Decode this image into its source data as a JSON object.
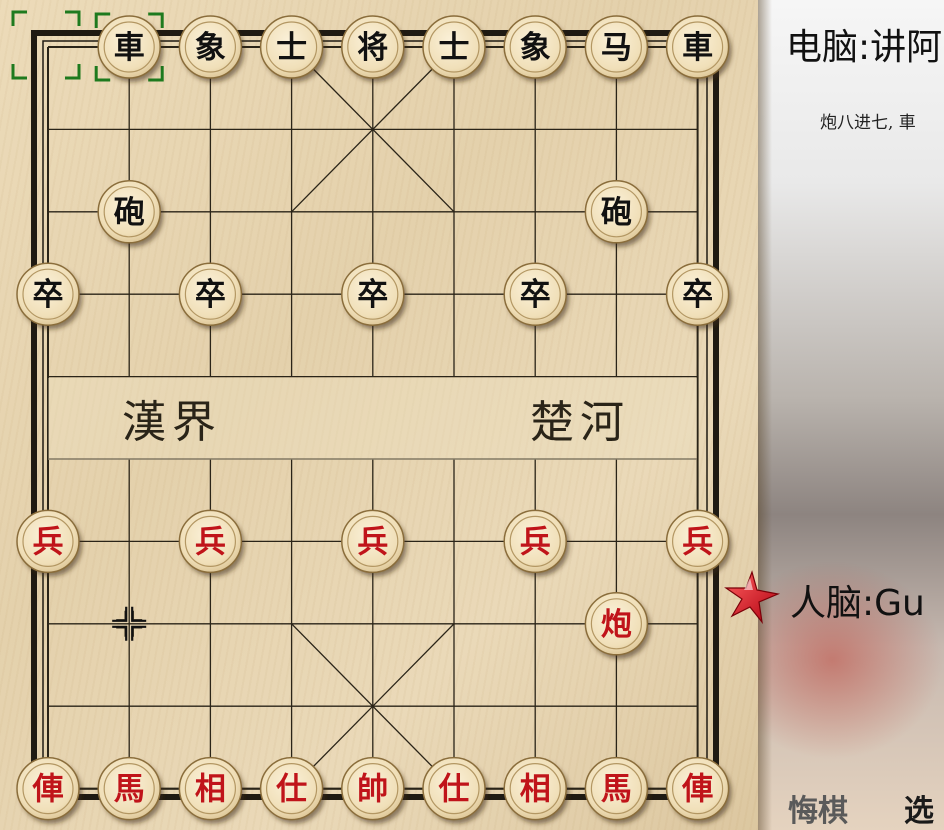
{
  "players": {
    "computer_label": "电脑:讲阿",
    "human_label": "人脑:Gu"
  },
  "move_notation": "炮八进七, 車",
  "buttons": {
    "undo": "悔棋",
    "select": "选"
  },
  "river": {
    "left_text": "漢界",
    "right_text": "楚河"
  },
  "pieces": [
    {
      "label": "車",
      "side": "black",
      "file": 1,
      "rank": 0
    },
    {
      "label": "象",
      "side": "black",
      "file": 2,
      "rank": 0
    },
    {
      "label": "士",
      "side": "black",
      "file": 3,
      "rank": 0
    },
    {
      "label": "将",
      "side": "black",
      "file": 4,
      "rank": 0
    },
    {
      "label": "士",
      "side": "black",
      "file": 5,
      "rank": 0
    },
    {
      "label": "象",
      "side": "black",
      "file": 6,
      "rank": 0
    },
    {
      "label": "马",
      "side": "black",
      "file": 7,
      "rank": 0
    },
    {
      "label": "車",
      "side": "black",
      "file": 8,
      "rank": 0
    },
    {
      "label": "砲",
      "side": "black",
      "file": 1,
      "rank": 2
    },
    {
      "label": "砲",
      "side": "black",
      "file": 7,
      "rank": 2
    },
    {
      "label": "卒",
      "side": "black",
      "file": 0,
      "rank": 3
    },
    {
      "label": "卒",
      "side": "black",
      "file": 2,
      "rank": 3
    },
    {
      "label": "卒",
      "side": "black",
      "file": 4,
      "rank": 3
    },
    {
      "label": "卒",
      "side": "black",
      "file": 6,
      "rank": 3
    },
    {
      "label": "卒",
      "side": "black",
      "file": 8,
      "rank": 3
    },
    {
      "label": "兵",
      "side": "red",
      "file": 0,
      "rank": 6
    },
    {
      "label": "兵",
      "side": "red",
      "file": 2,
      "rank": 6
    },
    {
      "label": "兵",
      "side": "red",
      "file": 4,
      "rank": 6
    },
    {
      "label": "兵",
      "side": "red",
      "file": 6,
      "rank": 6
    },
    {
      "label": "兵",
      "side": "red",
      "file": 8,
      "rank": 6
    },
    {
      "label": "炮",
      "side": "red",
      "file": 7,
      "rank": 7
    },
    {
      "label": "俥",
      "side": "red",
      "file": 0,
      "rank": 9
    },
    {
      "label": "馬",
      "side": "red",
      "file": 1,
      "rank": 9
    },
    {
      "label": "相",
      "side": "red",
      "file": 2,
      "rank": 9
    },
    {
      "label": "仕",
      "side": "red",
      "file": 3,
      "rank": 9
    },
    {
      "label": "帥",
      "side": "red",
      "file": 4,
      "rank": 9
    },
    {
      "label": "仕",
      "side": "red",
      "file": 5,
      "rank": 9
    },
    {
      "label": "相",
      "side": "red",
      "file": 6,
      "rank": 9
    },
    {
      "label": "馬",
      "side": "red",
      "file": 7,
      "rank": 9
    },
    {
      "label": "俥",
      "side": "red",
      "file": 8,
      "rank": 9
    }
  ],
  "last_move": {
    "from": {
      "file": 0,
      "rank": 0
    },
    "to": {
      "file": 1,
      "rank": 0
    }
  },
  "cursor_point": {
    "file": 1,
    "rank": 7
  },
  "colors": {
    "red_piece_text": "#c0141a",
    "black_piece_text": "#111111",
    "selection": "#1e7a1e",
    "board_line": "#2a2418"
  }
}
